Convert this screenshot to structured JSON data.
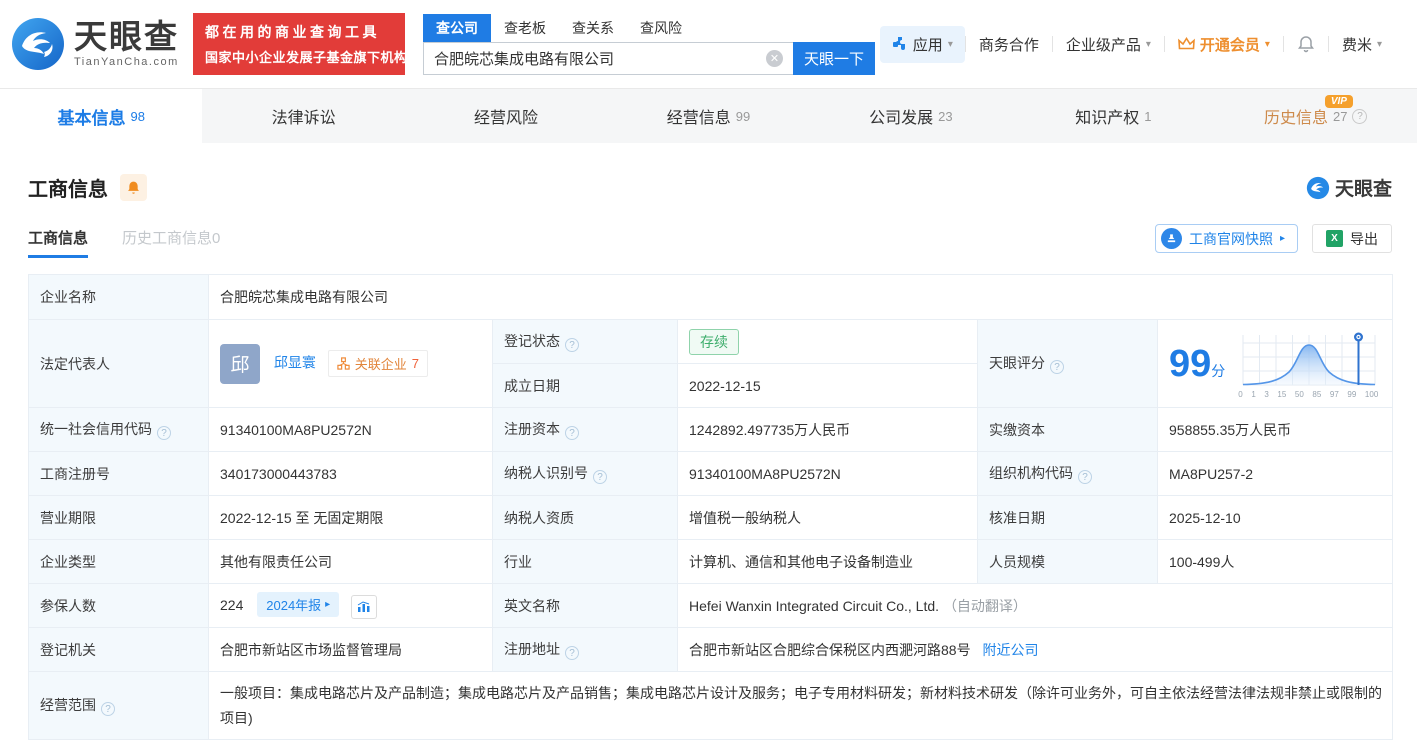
{
  "brand": {
    "name": "天眼查",
    "domain": "TianYanCha.com",
    "slogan_line1": "都在用的商业查询工具",
    "slogan_line2": "国家中小企业发展子基金旗下机构"
  },
  "colors": {
    "primary": "#1f7ce4",
    "banner_red": "#e23c39",
    "vip_orange": "#ee8f2f",
    "status_green": "#3fae6d",
    "link_blue": "#2084e8",
    "history_tab": "#cd8a4b"
  },
  "glyphs": {
    "caret": "▾",
    "arrow_right": "▸",
    "help": "?",
    "clear": "✕",
    "excel": "X",
    "vip": "VIP"
  },
  "search": {
    "tabs": [
      {
        "label": "查公司"
      },
      {
        "label": "查老板"
      },
      {
        "label": "查关系"
      },
      {
        "label": "查风险"
      }
    ],
    "value": "合肥皖芯集成电路有限公司",
    "button": "天眼一下"
  },
  "header_right": {
    "app": "应用",
    "cooperation": "商务合作",
    "enterprise": "企业级产品",
    "vip": "开通会员",
    "user": "费米"
  },
  "nav_tabs": [
    {
      "label": "基本信息",
      "count": "98"
    },
    {
      "label": "法律诉讼",
      "count": ""
    },
    {
      "label": "经营风险",
      "count": ""
    },
    {
      "label": "经营信息",
      "count": "99"
    },
    {
      "label": "公司发展",
      "count": "23"
    },
    {
      "label": "知识产权",
      "count": "1"
    },
    {
      "label": "历史信息",
      "count": "27"
    }
  ],
  "section": {
    "title": "工商信息",
    "subtab_current": "工商信息",
    "subtab_history": "历史工商信息0",
    "snapshot_button": "工商官网快照",
    "export_button": "导出",
    "watermark_brand": "天眼查"
  },
  "info": {
    "company_name_label": "企业名称",
    "company_name": "合肥皖芯集成电路有限公司",
    "legal_rep_label": "法定代表人",
    "legal_rep_avatar": "邱",
    "legal_rep_name": "邱显寰",
    "related_label": "关联企业",
    "related_count": "7",
    "reg_status_label": "登记状态",
    "reg_status": "存续",
    "est_date_label": "成立日期",
    "est_date": "2022-12-15",
    "score_label": "天眼评分",
    "score_value": "99",
    "score_unit": "分",
    "uscc_label": "统一社会信用代码",
    "uscc": "91340100MA8PU2572N",
    "reg_capital_label": "注册资本",
    "reg_capital": "1242892.497735万人民币",
    "paid_capital_label": "实缴资本",
    "paid_capital": "958855.35万人民币",
    "reg_no_label": "工商注册号",
    "reg_no": "340173000443783",
    "taxpayer_id_label": "纳税人识别号",
    "taxpayer_id": "91340100MA8PU2572N",
    "org_code_label": "组织机构代码",
    "org_code": "MA8PU257-2",
    "term_label": "营业期限",
    "term": "2022-12-15 至 无固定期限",
    "taxpayer_quality_label": "纳税人资质",
    "taxpayer_quality": "增值税一般纳税人",
    "approval_date_label": "核准日期",
    "approval_date": "2025-12-10",
    "company_type_label": "企业类型",
    "company_type": "其他有限责任公司",
    "industry_label": "行业",
    "industry": "计算机、通信和其他电子设备制造业",
    "staff_size_label": "人员规模",
    "staff_size": "100-499人",
    "insured_label": "参保人数",
    "insured_count": "224",
    "annual_report": "2024年报",
    "en_name_label": "英文名称",
    "en_name": "Hefei Wanxin Integrated Circuit Co., Ltd.",
    "en_name_note": "（自动翻译）",
    "reg_authority_label": "登记机关",
    "reg_authority": "合肥市新站区市场监督管理局",
    "address_label": "注册地址",
    "address": "合肥市新站区合肥综合保税区内西淝河路88号",
    "nearby_link": "附近公司",
    "scope_label": "经营范围",
    "scope": "一般项目：集成电路芯片及产品制造；集成电路芯片及产品销售；集成电路芯片设计及服务；电子专用材料研发；新材料技术研发（除许可业务外，可自主依法经营法律法规非禁止或限制的项目)"
  },
  "chart_data": {
    "type": "area",
    "title": "天眼评分分布曲线",
    "x_ticks": [
      "0",
      "1",
      "3",
      "15",
      "50",
      "85",
      "97",
      "99",
      "100"
    ],
    "marker_value": "99",
    "shape": "bell-curve"
  }
}
